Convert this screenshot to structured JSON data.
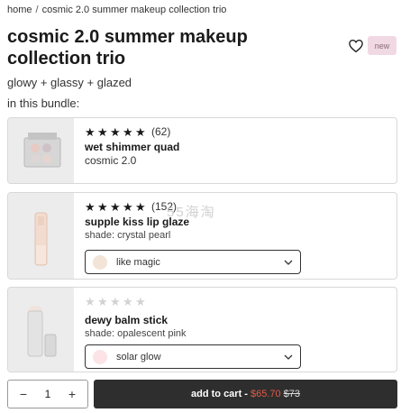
{
  "breadcrumb": {
    "home": "home",
    "separator": "/",
    "current": "cosmic 2.0 summer makeup collection trio"
  },
  "product": {
    "title": "cosmic 2.0 summer makeup collection trio",
    "badge": "new",
    "subtitle": "glowy + glassy + glazed",
    "bundle_label": "in this bundle:"
  },
  "items": [
    {
      "stars_filled": 5,
      "stars_total": 5,
      "review_count": "(62)",
      "name": "wet shimmer quad",
      "variant": "cosmic 2.0"
    },
    {
      "stars_filled": 5,
      "stars_total": 5,
      "review_count": "(152)",
      "name": "supple kiss lip glaze",
      "shade": "shade: crystal pearl",
      "select_value": "like magic",
      "swatch_color": "#f3e4d8"
    },
    {
      "stars_filled": 0,
      "stars_total": 5,
      "review_count": "",
      "name": "dewy balm stick",
      "shade": "shade: opalescent pink",
      "select_value": "solar glow",
      "swatch_color": "#fbe3e6"
    }
  ],
  "quantity": {
    "value": "1",
    "minus": "−",
    "plus": "+"
  },
  "cart": {
    "label": "add to cart -",
    "sale_price": "$65.70",
    "original_price": "$73"
  },
  "watermark": "55海淘",
  "colors": {
    "badge_bg": "#f1d9e3",
    "cart_bg": "#2e2e2e",
    "sale_price": "#e25b45"
  }
}
